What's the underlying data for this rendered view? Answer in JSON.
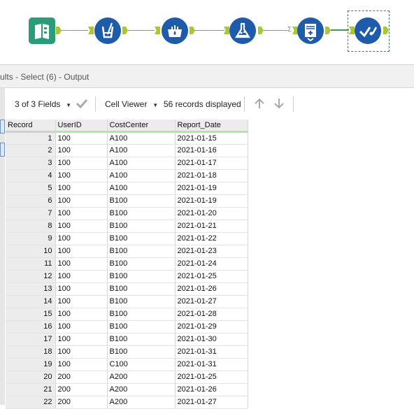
{
  "workflow": {
    "tools": [
      {
        "name": "input-data-icon",
        "selected": false
      },
      {
        "name": "select-tool-icon",
        "selected": false
      },
      {
        "name": "data-cleansing-icon",
        "selected": false
      },
      {
        "name": "formula-tool-icon",
        "selected": false
      },
      {
        "name": "summarize-tool-icon",
        "selected": false
      },
      {
        "name": "browse-tool-icon",
        "selected": true
      }
    ],
    "connector_label": "Σ",
    "colors": {
      "tool_blue": "#1e5ba8",
      "input_green": "#2a9c7c",
      "anchor": "#a7c63a"
    }
  },
  "results": {
    "title": "ults - Select (6) - Output"
  },
  "toolbar": {
    "fields_label": "3 of 3 Fields",
    "viewer_label": "Cell Viewer",
    "records_label": "56 records displayed"
  },
  "grid": {
    "headers": [
      "Record",
      "UserID",
      "CostCenter",
      "Report_Date"
    ],
    "rows": [
      [
        "1",
        "100",
        "A100",
        "2021-01-15"
      ],
      [
        "2",
        "100",
        "A100",
        "2021-01-16"
      ],
      [
        "3",
        "100",
        "A100",
        "2021-01-17"
      ],
      [
        "4",
        "100",
        "A100",
        "2021-01-18"
      ],
      [
        "5",
        "100",
        "A100",
        "2021-01-19"
      ],
      [
        "6",
        "100",
        "B100",
        "2021-01-19"
      ],
      [
        "7",
        "100",
        "B100",
        "2021-01-20"
      ],
      [
        "8",
        "100",
        "B100",
        "2021-01-21"
      ],
      [
        "9",
        "100",
        "B100",
        "2021-01-22"
      ],
      [
        "10",
        "100",
        "B100",
        "2021-01-23"
      ],
      [
        "11",
        "100",
        "B100",
        "2021-01-24"
      ],
      [
        "12",
        "100",
        "B100",
        "2021-01-25"
      ],
      [
        "13",
        "100",
        "B100",
        "2021-01-26"
      ],
      [
        "14",
        "100",
        "B100",
        "2021-01-27"
      ],
      [
        "15",
        "100",
        "B100",
        "2021-01-28"
      ],
      [
        "16",
        "100",
        "B100",
        "2021-01-29"
      ],
      [
        "17",
        "100",
        "B100",
        "2021-01-30"
      ],
      [
        "18",
        "100",
        "B100",
        "2021-01-31"
      ],
      [
        "19",
        "100",
        "C100",
        "2021-01-31"
      ],
      [
        "20",
        "200",
        "A200",
        "2021-01-25"
      ],
      [
        "21",
        "200",
        "A200",
        "2021-01-26"
      ],
      [
        "22",
        "200",
        "A200",
        "2021-01-27"
      ]
    ]
  }
}
